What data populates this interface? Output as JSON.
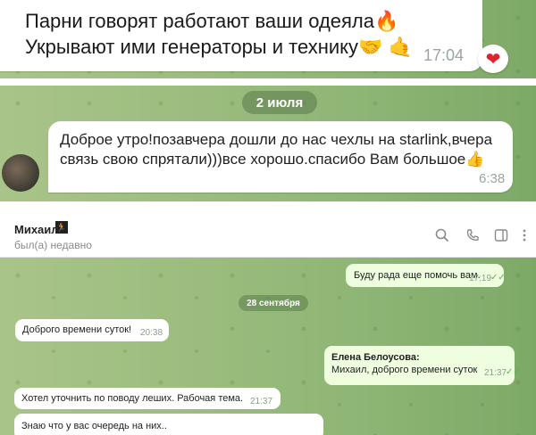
{
  "panel1": {
    "message_line1": "Парни говорят работают ваши одеяла",
    "message_line2": "Укрывают ими генераторы и технику",
    "emoji1": "🔥",
    "emoji2": "🤝",
    "emoji3": "🤙",
    "time": "17:04",
    "reaction": "❤"
  },
  "panel2": {
    "date_label": "2 июля",
    "message_line1": "Доброе утро!позавчера дошли до нас чехлы на starlink,вчера",
    "message_line2": "связь свою спрятали)))все хорошо.спасибо Вам большое",
    "emoji": "👍",
    "time": "6:38"
  },
  "panel3": {
    "contact_name": "Михаил",
    "contact_badge": "🏃",
    "status": "был(а) недавно",
    "header_icons": [
      "search-icon",
      "phone-icon",
      "sidebar-icon",
      "more-icon"
    ],
    "messages": [
      {
        "text": "Буду рада еще помочь вам.",
        "time": "17:19",
        "outgoing": true
      },
      {
        "text": "Доброго времени суток!",
        "time": "20:38",
        "outgoing": false
      },
      {
        "author": "Елена Белоусова:",
        "text": "Михаил, доброго времени суток",
        "time": "21:37",
        "outgoing": true
      },
      {
        "text": "Хотел уточнить по поводу леших. Рабочая тема.",
        "time": "21:37",
        "outgoing": false
      },
      {
        "text": "Знаю что у вас очередь на них..",
        "outgoing": false
      }
    ],
    "date_label": "28 сентября",
    "checkmarks": "✓✓"
  }
}
